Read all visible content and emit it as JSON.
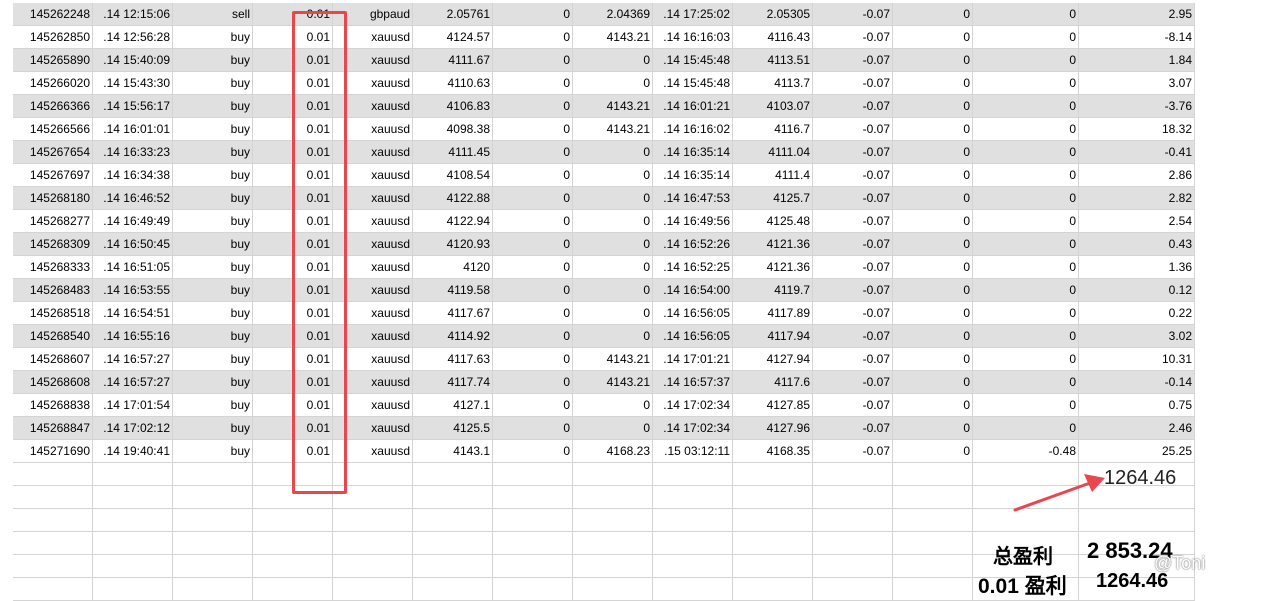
{
  "rows": [
    [
      "145262248",
      ".14 12:15:06",
      "sell",
      "0.01",
      "gbpaud",
      "2.05761",
      "0",
      "2.04369",
      ".14 17:25:02",
      "2.05305",
      "-0.07",
      "0",
      "0",
      "2.95"
    ],
    [
      "145262850",
      ".14 12:56:28",
      "buy",
      "0.01",
      "xauusd",
      "4124.57",
      "0",
      "4143.21",
      ".14 16:16:03",
      "4116.43",
      "-0.07",
      "0",
      "0",
      "-8.14"
    ],
    [
      "145265890",
      ".14 15:40:09",
      "buy",
      "0.01",
      "xauusd",
      "4111.67",
      "0",
      "0",
      ".14 15:45:48",
      "4113.51",
      "-0.07",
      "0",
      "0",
      "1.84"
    ],
    [
      "145266020",
      ".14 15:43:30",
      "buy",
      "0.01",
      "xauusd",
      "4110.63",
      "0",
      "0",
      ".14 15:45:48",
      "4113.7",
      "-0.07",
      "0",
      "0",
      "3.07"
    ],
    [
      "145266366",
      ".14 15:56:17",
      "buy",
      "0.01",
      "xauusd",
      "4106.83",
      "0",
      "4143.21",
      ".14 16:01:21",
      "4103.07",
      "-0.07",
      "0",
      "0",
      "-3.76"
    ],
    [
      "145266566",
      ".14 16:01:01",
      "buy",
      "0.01",
      "xauusd",
      "4098.38",
      "0",
      "4143.21",
      ".14 16:16:02",
      "4116.7",
      "-0.07",
      "0",
      "0",
      "18.32"
    ],
    [
      "145267654",
      ".14 16:33:23",
      "buy",
      "0.01",
      "xauusd",
      "4111.45",
      "0",
      "0",
      ".14 16:35:14",
      "4111.04",
      "-0.07",
      "0",
      "0",
      "-0.41"
    ],
    [
      "145267697",
      ".14 16:34:38",
      "buy",
      "0.01",
      "xauusd",
      "4108.54",
      "0",
      "0",
      ".14 16:35:14",
      "4111.4",
      "-0.07",
      "0",
      "0",
      "2.86"
    ],
    [
      "145268180",
      ".14 16:46:52",
      "buy",
      "0.01",
      "xauusd",
      "4122.88",
      "0",
      "0",
      ".14 16:47:53",
      "4125.7",
      "-0.07",
      "0",
      "0",
      "2.82"
    ],
    [
      "145268277",
      ".14 16:49:49",
      "buy",
      "0.01",
      "xauusd",
      "4122.94",
      "0",
      "0",
      ".14 16:49:56",
      "4125.48",
      "-0.07",
      "0",
      "0",
      "2.54"
    ],
    [
      "145268309",
      ".14 16:50:45",
      "buy",
      "0.01",
      "xauusd",
      "4120.93",
      "0",
      "0",
      ".14 16:52:26",
      "4121.36",
      "-0.07",
      "0",
      "0",
      "0.43"
    ],
    [
      "145268333",
      ".14 16:51:05",
      "buy",
      "0.01",
      "xauusd",
      "4120",
      "0",
      "0",
      ".14 16:52:25",
      "4121.36",
      "-0.07",
      "0",
      "0",
      "1.36"
    ],
    [
      "145268483",
      ".14 16:53:55",
      "buy",
      "0.01",
      "xauusd",
      "4119.58",
      "0",
      "0",
      ".14 16:54:00",
      "4119.7",
      "-0.07",
      "0",
      "0",
      "0.12"
    ],
    [
      "145268518",
      ".14 16:54:51",
      "buy",
      "0.01",
      "xauusd",
      "4117.67",
      "0",
      "0",
      ".14 16:56:05",
      "4117.89",
      "-0.07",
      "0",
      "0",
      "0.22"
    ],
    [
      "145268540",
      ".14 16:55:16",
      "buy",
      "0.01",
      "xauusd",
      "4114.92",
      "0",
      "0",
      ".14 16:56:05",
      "4117.94",
      "-0.07",
      "0",
      "0",
      "3.02"
    ],
    [
      "145268607",
      ".14 16:57:27",
      "buy",
      "0.01",
      "xauusd",
      "4117.63",
      "0",
      "4143.21",
      ".14 17:01:21",
      "4127.94",
      "-0.07",
      "0",
      "0",
      "10.31"
    ],
    [
      "145268608",
      ".14 16:57:27",
      "buy",
      "0.01",
      "xauusd",
      "4117.74",
      "0",
      "4143.21",
      ".14 16:57:37",
      "4117.6",
      "-0.07",
      "0",
      "0",
      "-0.14"
    ],
    [
      "145268838",
      ".14 17:01:54",
      "buy",
      "0.01",
      "xauusd",
      "4127.1",
      "0",
      "0",
      ".14 17:02:34",
      "4127.85",
      "-0.07",
      "0",
      "0",
      "0.75"
    ],
    [
      "145268847",
      ".14 17:02:12",
      "buy",
      "0.01",
      "xauusd",
      "4125.5",
      "0",
      "0",
      ".14 17:02:34",
      "4127.96",
      "-0.07",
      "0",
      "0",
      "2.46"
    ],
    [
      "145271690",
      ".14 19:40:41",
      "buy",
      "0.01",
      "xauusd",
      "4143.1",
      "0",
      "4168.23",
      ".15 03:12:11",
      "4168.35",
      "-0.07",
      "0",
      "-0.48",
      "25.25"
    ]
  ],
  "profit_sum": "1264.46",
  "summary": {
    "total_label": "总盈利",
    "total_value": "2 853.24",
    "lot_label": "0.01 盈利",
    "lot_value": "1264.46"
  },
  "watermark": "@Toni",
  "colors": {
    "highlight_box": "#e8474f",
    "arrow": "#e8474f",
    "shaded_row": "#e0e0e0",
    "grid_line": "#d4d4d4"
  }
}
